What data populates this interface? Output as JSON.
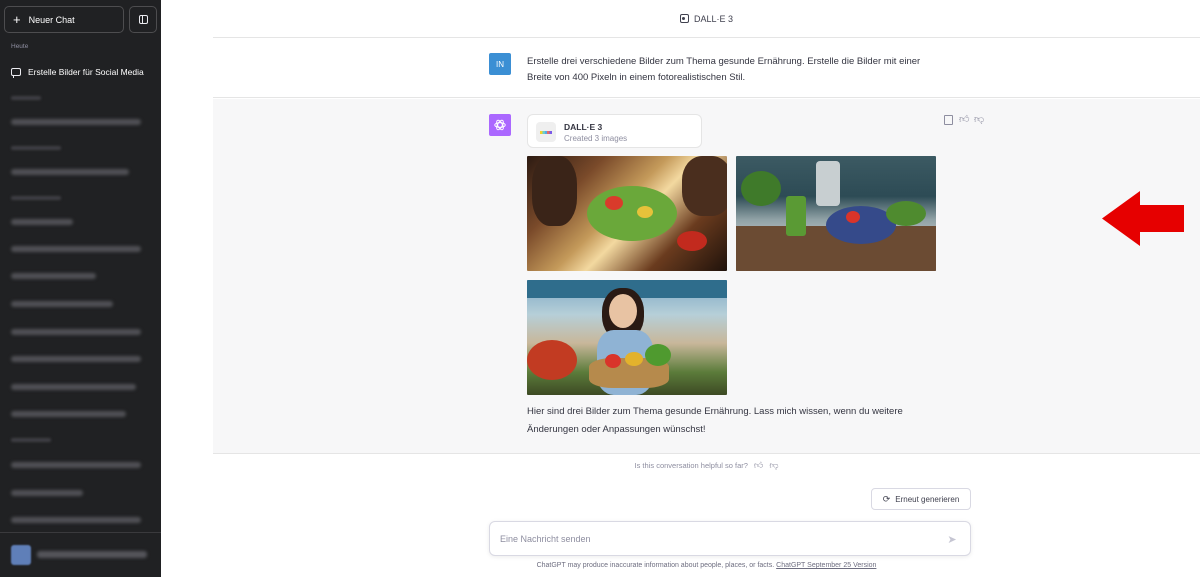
{
  "sidebar": {
    "new_chat_label": "Neuer Chat",
    "group_today": "Heute",
    "active_item": "Erstelle Bilder für Social Media"
  },
  "header": {
    "model_label": "DALL·E 3"
  },
  "user_message": {
    "avatar_initials": "IN",
    "text": "Erstelle drei verschiedene Bilder zum Thema gesunde Ernährung. Erstelle die Bilder mit einer Breite von 400 Pixeln in einem fotorealistischen Stil."
  },
  "assistant_message": {
    "tool_card": {
      "title": "DALL·E 3",
      "subtitle": "Created 3 images"
    },
    "text": "Hier sind drei Bilder zum Thema gesunde Ernährung. Lass mich wissen, wenn du weitere Änderungen oder Anpassungen wünschst!"
  },
  "feedback": {
    "prompt": "Is this conversation helpful so far?"
  },
  "regenerate_label": "Erneut generieren",
  "composer": {
    "placeholder": "Eine Nachricht senden"
  },
  "footer": {
    "disclaimer": "ChatGPT may produce inaccurate information about people, places, or facts.",
    "version_link": "ChatGPT September 25 Version"
  },
  "colors": {
    "sidebar_bg": "#202123",
    "user_badge": "#3b8fd4",
    "gpt_badge": "#ab68ff",
    "annotation_arrow": "#e60000"
  }
}
